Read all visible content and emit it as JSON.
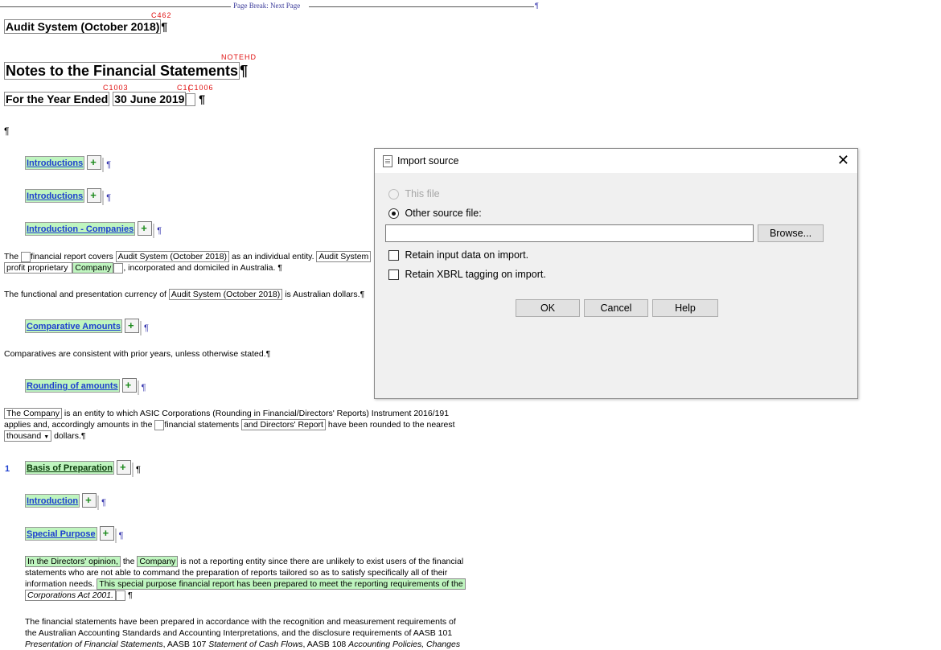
{
  "page_break": {
    "label": "Page Break: Next Page",
    "mark": "¶"
  },
  "tags": {
    "c462": "C462",
    "notehd": "NOTEHD",
    "c1003": "C1003",
    "c1c": "C1(",
    "c1006": "C1006"
  },
  "doc": {
    "title": "Audit System (October 2018)",
    "notes_title": "Notes to the Financial Statements",
    "year_ended_prefix": "For the Year Ended",
    "year_ended_date": "30 June 2019",
    "pilcrow": "¶",
    "headings": {
      "intro1": "Introductions",
      "intro2": "Introductions",
      "intro_companies": "Introduction - Companies",
      "comparative": "Comparative Amounts",
      "rounding": "Rounding of amounts",
      "basis": "Basis of Preparation",
      "introduction": "Introduction",
      "special_purpose": "Special Purpose"
    },
    "section_number": "1",
    "p1": {
      "a": "The ",
      "b": "financial report covers ",
      "entity": "Audit System (October 2018)",
      "c": " as an individual entity. ",
      "entity2": "Audit System",
      "line2_a": "profit proprietary ",
      "company": "Company",
      "line2_b": ", incorporated and domiciled in Australia. ¶"
    },
    "p2": {
      "a": "The functional and presentation currency of ",
      "entity": "Audit System (October 2018)",
      "b": " is Australian dollars.¶"
    },
    "p3": "Comparatives are consistent with prior years, unless otherwise stated.¶",
    "p4": {
      "company": "The Company",
      "a": " is an entity to which ASIC Corporations (Rounding in Financial/Directors' Reports) Instrument 2016/191",
      "b": "applies and, accordingly amounts in the ",
      "c": "financial statements ",
      "dr": "and Directors' Report",
      "d": " have been rounded to the nearest",
      "thousand": "thousand",
      "e": " dollars.¶"
    },
    "p5": {
      "opinion": "In the Directors' opinion,",
      "a": " the ",
      "company": "Company",
      "b": " is not a reporting entity since there are unlikely to exist users of the financial",
      "line2": "statements who are not able to command the preparation of reports tailored so as to satisfy specifically all of their",
      "line3a": "information needs. ",
      "special": "This special purpose financial report has been prepared to meet the reporting requirements of the",
      "act": "Corporations Act 2001.",
      "end": "¶"
    },
    "p6": {
      "line1": "The financial statements have been prepared in accordance with the recognition and measurement requirements of",
      "line2": "the Australian Accounting Standards and Accounting Interpretations, and the disclosure requirements of AASB 101",
      "line3a": "Presentation of Financial Statements",
      "line3b": ", AASB 107 ",
      "line3c": "Statement of Cash Flows",
      "line3d": ", AASB 108 ",
      "line3e": "Accounting Policies, Changes"
    }
  },
  "dialog": {
    "title": "Import source",
    "close_glyph": "✕",
    "opt_this_file": "This file",
    "opt_other": "Other source file:",
    "path_value": "",
    "browse": "Browse...",
    "retain_input": "Retain input data on import.",
    "retain_xbrl": "Retain XBRL tagging on import.",
    "ok": "OK",
    "cancel": "Cancel",
    "help": "Help"
  }
}
